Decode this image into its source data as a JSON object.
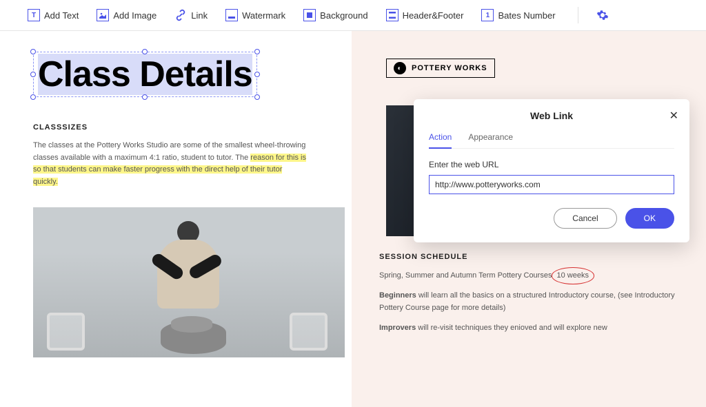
{
  "toolbar": {
    "items": [
      {
        "label": "Add Text",
        "icon": "T"
      },
      {
        "label": "Add Image",
        "icon": "img"
      },
      {
        "label": "Link",
        "icon": "link"
      },
      {
        "label": "Watermark",
        "icon": "wm"
      },
      {
        "label": "Background",
        "icon": "bg"
      },
      {
        "label": "Header&Footer",
        "icon": "hf"
      },
      {
        "label": "Bates Number",
        "icon": "1"
      }
    ]
  },
  "doc": {
    "title": "Class Details",
    "section1": {
      "heading": "CLASSSIZES",
      "p1": "The classes at the Pottery Works Studio are some of the smallest wheel-throwing classes available with a maximum 4:1 ratio, student to tutor. The ",
      "hl": "reason for this is so that students can make faster progress with the direct help of their tutor quickly."
    },
    "brand": "POTTERY WORKS",
    "section2": {
      "heading": "SESSION SCHEDULE",
      "line1_a": "Spring, Summer and Autumn Term Pottery Courses ",
      "line1_circled": "10 weeks",
      "line2_bold": "Beginners",
      "line2_rest": " will learn all the basics on a structured Introductory course, (see Introductory Pottery Course page for more details)",
      "line3_bold": "Improvers",
      "line3_rest": " will re-visit techniques they enioved and will explore new"
    }
  },
  "modal": {
    "title": "Web Link",
    "tabs": {
      "action": "Action",
      "appearance": "Appearance"
    },
    "field_label": "Enter the web URL",
    "url_value": "http://www.potteryworks.com",
    "cancel": "Cancel",
    "ok": "OK"
  }
}
